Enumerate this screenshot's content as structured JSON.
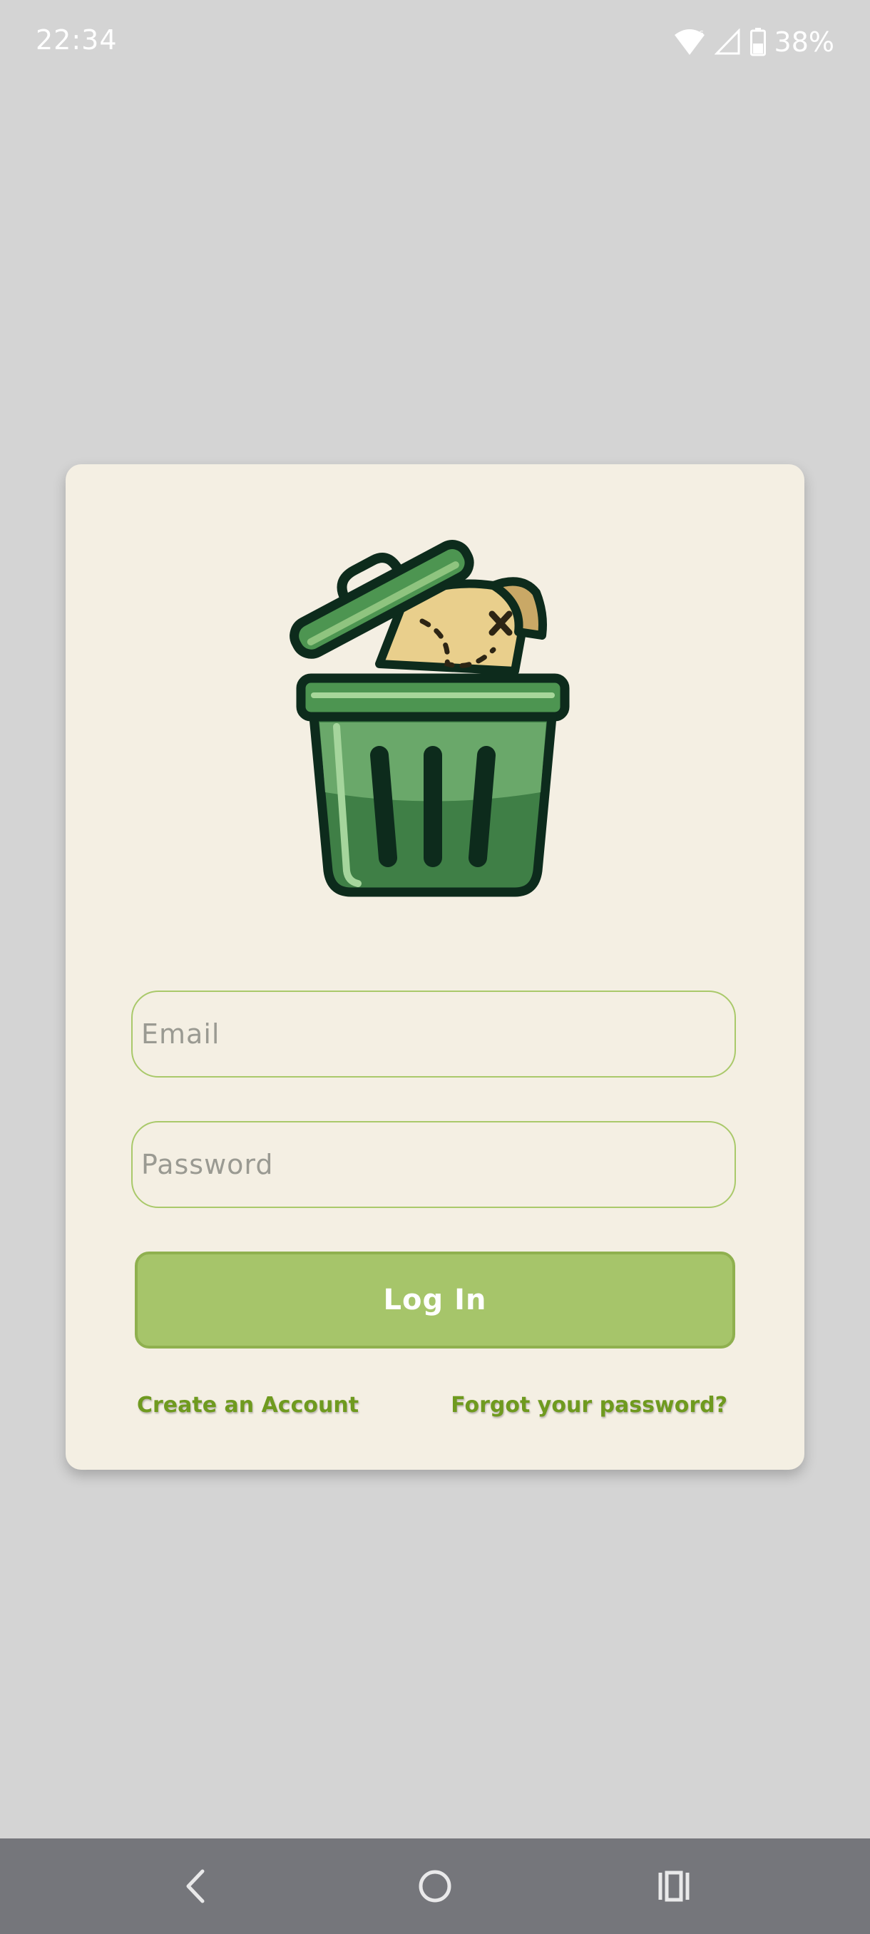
{
  "status_bar": {
    "time": "22:34",
    "battery": "38%",
    "icons": [
      "wifi-icon",
      "cell-signal-icon",
      "battery-icon"
    ]
  },
  "login": {
    "logo_icon": "trash-can-icon",
    "email_placeholder": "Email",
    "password_placeholder": "Password",
    "login_label": "Log In",
    "create_account_label": "Create an Account",
    "forgot_password_label": "Forgot your password?"
  },
  "nav_bar": {
    "icons": [
      "back-icon",
      "home-icon",
      "recent-apps-icon"
    ]
  },
  "colors": {
    "background": "#d4d4d4",
    "card": "#f4efe3",
    "accent": "#a6c56a",
    "link": "#6f9a1f",
    "nav_bar": "#75767b"
  }
}
